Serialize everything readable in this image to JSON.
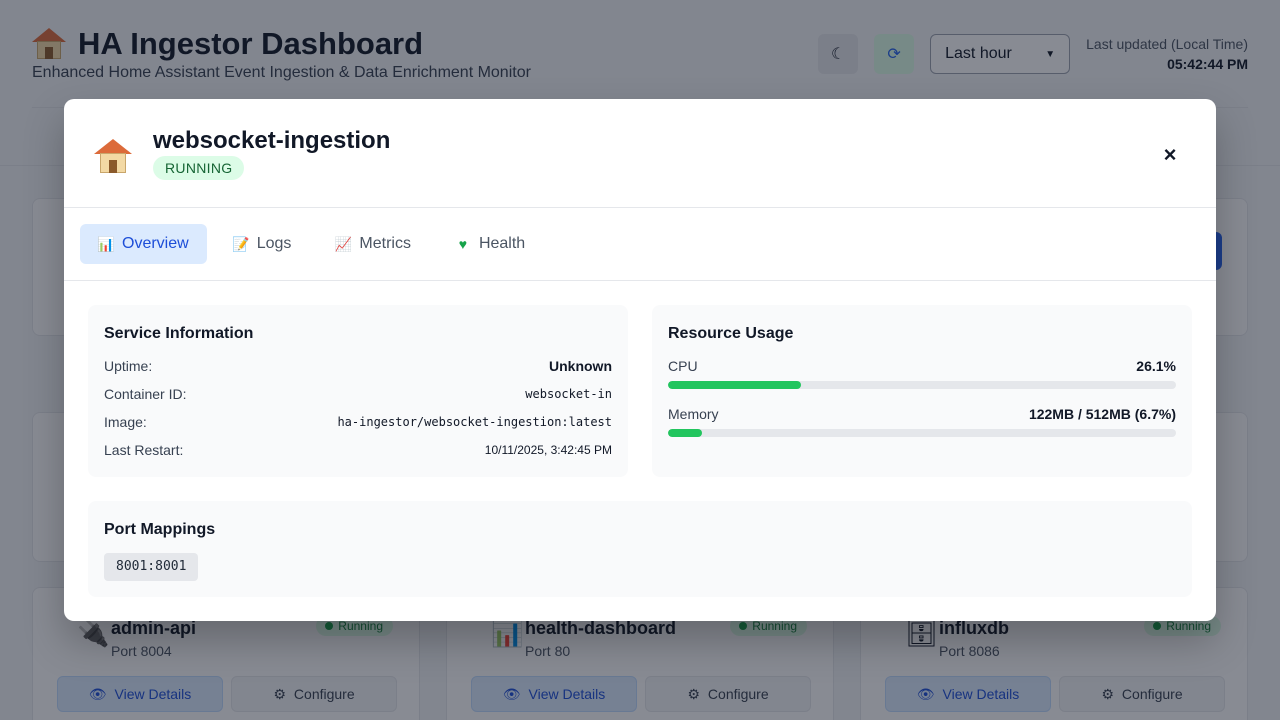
{
  "header": {
    "title": "HA Ingestor Dashboard",
    "subtitle": "Enhanced Home Assistant Event Ingestion & Data Enrichment Monitor",
    "theme_icon": "moon-icon",
    "refresh_icon": "refresh-icon",
    "time_range": "Last hour",
    "last_updated_label": "Last updated (Local Time)",
    "last_updated_value": "05:42:44 PM"
  },
  "services": [
    {
      "name": "admin-api",
      "port": "Port 8004",
      "status": "Running",
      "icon": "plug-icon",
      "view_label": "View Details",
      "config_label": "Configure"
    },
    {
      "name": "health-dashboard",
      "port": "Port 80",
      "status": "Running",
      "icon": "bar-chart-icon",
      "view_label": "View Details",
      "config_label": "Configure"
    },
    {
      "name": "influxdb",
      "port": "Port 8086",
      "status": "Running",
      "icon": "file-cabinet-icon",
      "view_label": "View Details",
      "config_label": "Configure"
    }
  ],
  "modal": {
    "service_name": "websocket-ingestion",
    "status": "RUNNING",
    "close_label": "×",
    "tabs": [
      {
        "label": "Overview",
        "icon": "bar-chart-icon",
        "active": true
      },
      {
        "label": "Logs",
        "icon": "memo-icon",
        "active": false
      },
      {
        "label": "Metrics",
        "icon": "line-chart-icon",
        "active": false
      },
      {
        "label": "Health",
        "icon": "green-heart-icon",
        "active": false
      }
    ],
    "service_info": {
      "title": "Service Information",
      "rows": [
        {
          "label": "Uptime:",
          "value": "Unknown"
        },
        {
          "label": "Container ID:",
          "value": "websocket-in"
        },
        {
          "label": "Image:",
          "value": "ha-ingestor/websocket-ingestion:latest"
        },
        {
          "label": "Last Restart:",
          "value": "10/11/2025, 3:42:45 PM"
        }
      ]
    },
    "resource_usage": {
      "title": "Resource Usage",
      "cpu": {
        "label": "CPU",
        "value": "26.1%",
        "fraction": 0.261
      },
      "memory": {
        "label": "Memory",
        "value": "122MB / 512MB (6.7%)",
        "fraction": 0.067
      }
    },
    "ports": {
      "title": "Port Mappings",
      "items": [
        "8001:8001"
      ]
    }
  },
  "colors": {
    "accent": "#2563eb",
    "success": "#22c55e",
    "tab_active_bg": "#dbeafe",
    "status_bg": "#dcfce7"
  }
}
